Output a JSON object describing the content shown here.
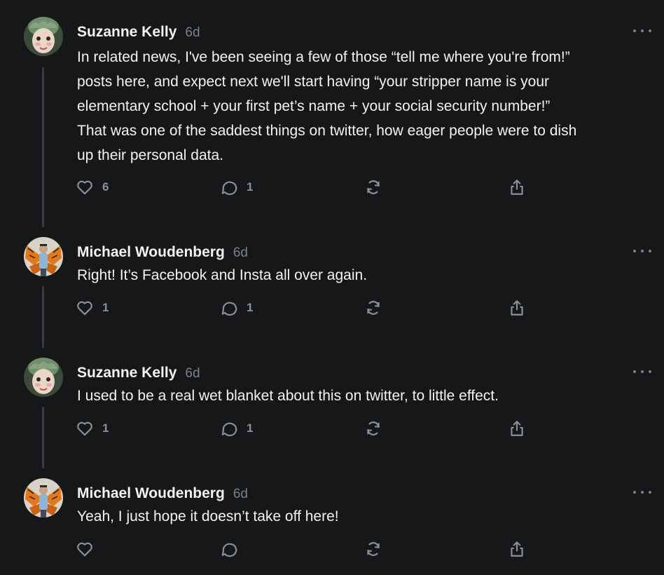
{
  "colors": {
    "background": "#161719",
    "text": "#f1f3f5",
    "muted": "#7b8088",
    "icon": "#8b9098",
    "thread_line": "#3a3d42"
  },
  "icons": {
    "like": "heart-icon",
    "reply": "speech-bubble-icon",
    "repost": "repost-arrows-icon",
    "share": "share-upload-icon",
    "more": "ellipsis-icon"
  },
  "posts": [
    {
      "author": "Suzanne Kelly",
      "time": "6d",
      "avatar": "suzanne-avatar",
      "lines": [
        "In related news, I've been seeing a few of those “tell me where you're from!”",
        "posts here, and expect next we'll start having “your stripper name is your",
        "elementary school + your first pet’s name + your social security number!”",
        "That was one of the saddest things on twitter, how eager people were to dish",
        "up their personal data."
      ],
      "likes": "6",
      "replies": "1"
    },
    {
      "author": "Michael Woudenberg",
      "time": "6d",
      "avatar": "michael-avatar",
      "lines": [
        "Right! It’s Facebook and Insta all over again."
      ],
      "likes": "1",
      "replies": "1"
    },
    {
      "author": "Suzanne Kelly",
      "time": "6d",
      "avatar": "suzanne-avatar",
      "lines": [
        "I used to be a real wet blanket about this on twitter, to little effect."
      ],
      "likes": "1",
      "replies": "1"
    },
    {
      "author": "Michael Woudenberg",
      "time": "6d",
      "avatar": "michael-avatar",
      "lines": [
        "Yeah, I just hope it doesn’t take off here!"
      ],
      "likes": "",
      "replies": ""
    }
  ]
}
